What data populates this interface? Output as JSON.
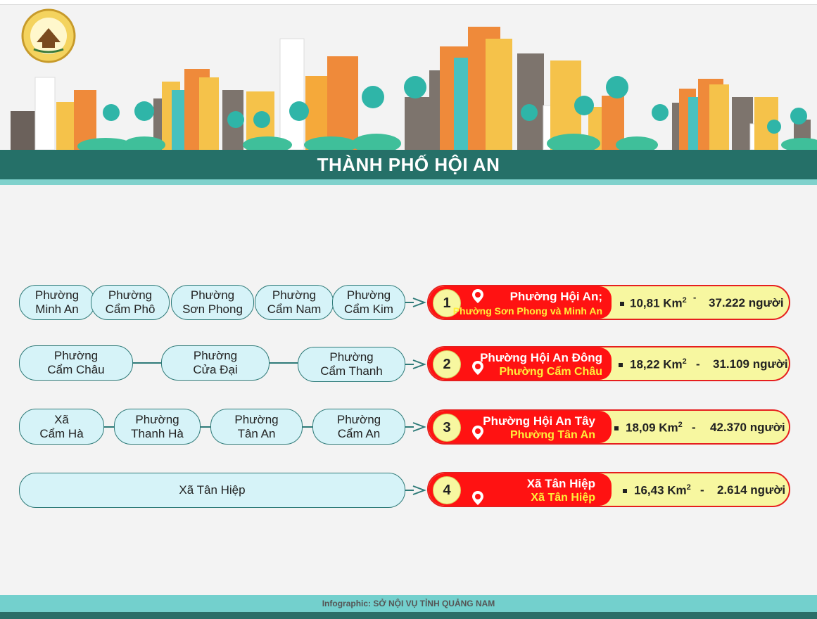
{
  "title": "THÀNH PHỐ HỘI AN",
  "footer": "Infographic: SỞ NỘI VỤ TỈNH QUẢNG NAM",
  "colors": {
    "teal_dark": "#257068",
    "teal_light": "#7fd1cc",
    "pill_bg": "#d6f3f8",
    "red": "#ff1212",
    "yellow": "#f7f7a0"
  },
  "icons": {
    "logo": "emblem-logo",
    "pin": "location-pin-icon",
    "arrow": "arrow-right-icon"
  },
  "rows": [
    {
      "sources": [
        {
          "line1": "Phường",
          "line2": "Minh An"
        },
        {
          "line1": "Phường",
          "line2": "Cẩm Phô"
        },
        {
          "line1": "Phường",
          "line2": "Sơn Phong"
        },
        {
          "line1": "Phường",
          "line2": "Cẩm Nam"
        },
        {
          "line1": "Phường",
          "line2": "Cẩm Kim"
        }
      ],
      "result": {
        "number": "1",
        "name": "Phường Hội An;",
        "merged": "Phường Sơn Phong và Minh An",
        "area": "10,81 Km",
        "sup": "2",
        "sep": "-",
        "population": "37.222 người"
      }
    },
    {
      "sources": [
        {
          "line1": "Phường",
          "line2": "Cẩm Châu"
        },
        {
          "line1": "Phường",
          "line2": "Cửa Đại"
        },
        {
          "line1": "Phường",
          "line2": "Cẩm Thanh"
        }
      ],
      "result": {
        "number": "2",
        "name": "Phường Hội  An  Đông",
        "merged": "Phường Cẩm Châu",
        "area": "18,22 Km",
        "sup": "2",
        "sep": "-",
        "population": "31.109 người"
      }
    },
    {
      "sources": [
        {
          "line1": "Xã",
          "line2": "Cẩm Hà"
        },
        {
          "line1": "Phường",
          "line2": "Thanh Hà"
        },
        {
          "line1": "Phường",
          "line2": "Tân An"
        },
        {
          "line1": "Phường",
          "line2": "Cẩm An"
        }
      ],
      "result": {
        "number": "3",
        "name": "Phường Hội  An  Tây",
        "merged": "Phường Tân An",
        "area": "18,09 Km",
        "sup": "2",
        "sep": "-",
        "population": "42.370 người"
      }
    },
    {
      "sources": [
        {
          "line1": "Xã Tân Hiệp",
          "line2": ""
        }
      ],
      "result": {
        "number": "4",
        "name": "Xã Tân Hiệp",
        "merged": "Xã Tân Hiệp",
        "area": "16,43 Km",
        "sup": "2",
        "sep": "-",
        "population": "2.614 người"
      }
    }
  ]
}
